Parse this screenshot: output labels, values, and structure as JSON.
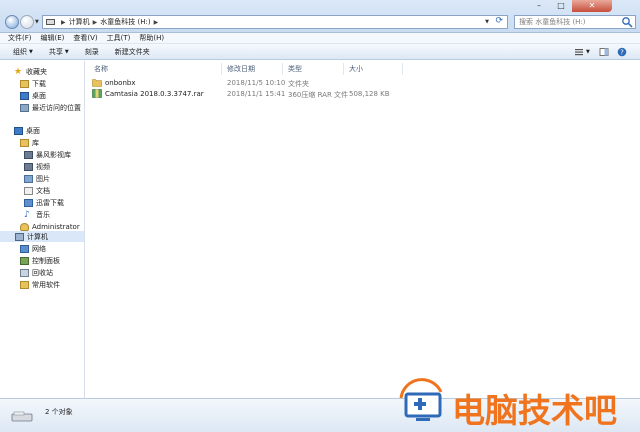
{
  "address": {
    "breadcrumbs": [
      "计算机",
      "水童鱼科技 (H:)"
    ],
    "search_placeholder": "搜索 水童鱼科技 (H:)"
  },
  "window_controls": [
    "–",
    "□",
    "✕"
  ],
  "menu": [
    "文件(F)",
    "编辑(E)",
    "查看(V)",
    "工具(T)",
    "帮助(H)"
  ],
  "commands": {
    "organize": "组织",
    "share": "共享",
    "burn": "刻录",
    "new_folder": "新建文件夹"
  },
  "nav": {
    "favorites": "收藏夹",
    "downloads": "下载",
    "desktop": "桌面",
    "recent": "最近访问的位置",
    "desktop2": "桌面",
    "libraries": "库",
    "storm": "暴风影视库",
    "videos": "视频",
    "pictures": "图片",
    "documents": "文档",
    "xunlei": "迅雷下载",
    "music": "音乐",
    "admin": "Administrator",
    "computer": "计算机",
    "network": "网络",
    "control_panel": "控制面板",
    "recycle": "回收站",
    "software": "常用软件"
  },
  "columns": {
    "name": "名称",
    "modified": "修改日期",
    "type": "类型",
    "size": "大小"
  },
  "files": [
    {
      "name": "onbonbx",
      "modified": "2018/11/5 10:10",
      "type": "文件夹",
      "size": ""
    },
    {
      "name": "Camtasia 2018.0.3.3747.rar",
      "modified": "2018/11/1 15:41",
      "type": "360压缩 RAR 文件",
      "size": "508,128 KB"
    }
  ],
  "status": {
    "count_text": "2 个对象"
  },
  "watermark": {
    "text": "电脑技术吧"
  },
  "colors": {
    "accent": "#2e6ab7",
    "watermark": "#f0741d",
    "folder": "#e8c25a"
  }
}
